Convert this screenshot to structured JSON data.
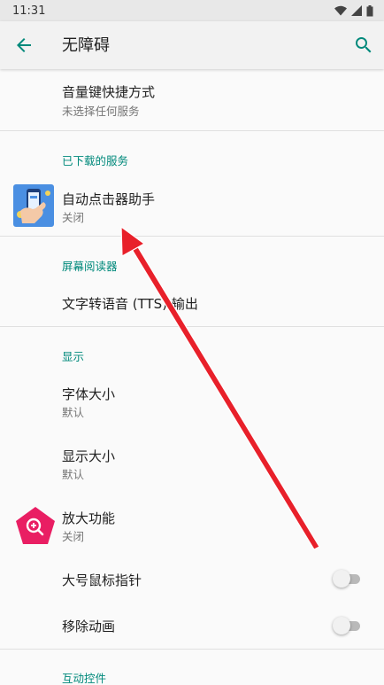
{
  "status_bar": {
    "time": "11:31"
  },
  "toolbar": {
    "title": "无障碍"
  },
  "items": {
    "volume_shortcut": {
      "label": "音量键快捷方式",
      "sub": "未选择任何服务"
    },
    "auto_clicker": {
      "label": "自动点击器助手",
      "sub": "关闭"
    },
    "tts_output": {
      "label": "文字转语音 (TTS) 输出"
    },
    "font_size": {
      "label": "字体大小",
      "sub": "默认"
    },
    "display_size": {
      "label": "显示大小",
      "sub": "默认"
    },
    "magnification": {
      "label": "放大功能",
      "sub": "关闭"
    },
    "large_pointer": {
      "label": "大号鼠标指针",
      "toggle": "off"
    },
    "remove_animations": {
      "label": "移除动画",
      "toggle": "off"
    }
  },
  "sections": {
    "downloaded": "已下载的服务",
    "screen_reader": "屏幕阅读器",
    "display": "显示",
    "interaction": "互动控件"
  },
  "colors": {
    "accent": "#00897b",
    "annotation_arrow": "#e8202a",
    "magnify_icon": "#e91e63"
  }
}
